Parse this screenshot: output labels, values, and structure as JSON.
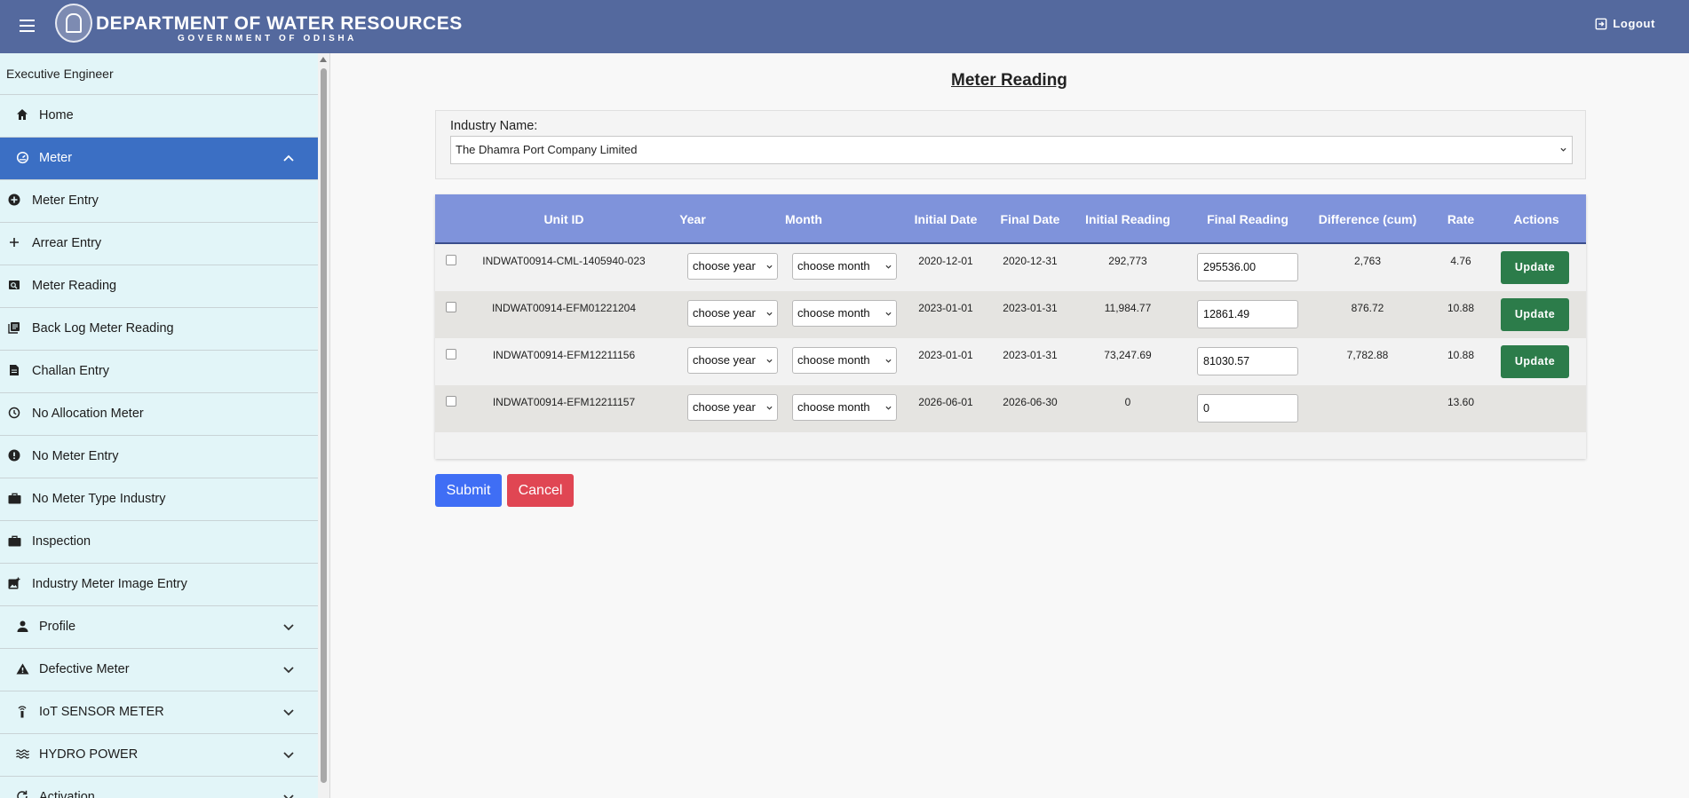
{
  "header": {
    "title": "DEPARTMENT OF WATER RESOURCES",
    "subtitle": "GOVERNMENT OF ODISHA",
    "logout_label": "Logout"
  },
  "sidebar": {
    "user_role": "Executive Engineer",
    "items": [
      {
        "label": "Home",
        "icon": "home-icon"
      },
      {
        "label": "Meter",
        "icon": "meter-icon",
        "active": true,
        "expanded": true
      },
      {
        "label": "Meter Entry",
        "icon": "plus-circle-icon"
      },
      {
        "label": "Arrear Entry",
        "icon": "plus-icon"
      },
      {
        "label": "Meter Reading",
        "icon": "reading-icon"
      },
      {
        "label": "Back Log Meter Reading",
        "icon": "library-icon"
      },
      {
        "label": "Challan Entry",
        "icon": "document-icon"
      },
      {
        "label": "No Allocation Meter",
        "icon": "history-icon"
      },
      {
        "label": "No Meter Entry",
        "icon": "error-icon"
      },
      {
        "label": "No Meter Type Industry",
        "icon": "briefcase-icon"
      },
      {
        "label": "Inspection",
        "icon": "briefcase-icon"
      },
      {
        "label": "Industry Meter Image Entry",
        "icon": "image-add-icon"
      },
      {
        "label": "Profile",
        "icon": "person-icon"
      },
      {
        "label": "Defective Meter",
        "icon": "warning-icon"
      },
      {
        "label": "IoT SENSOR METER",
        "icon": "sensor-icon"
      },
      {
        "label": "HYDRO POWER",
        "icon": "waves-icon"
      },
      {
        "label": "Activation",
        "icon": "refresh-icon"
      }
    ]
  },
  "main": {
    "title": "Meter Reading",
    "industry_label": "Industry Name:",
    "industry_value": "The Dhamra Port Company Limited",
    "table": {
      "headers": [
        "Unit ID",
        "Year",
        "Month",
        "Initial Date",
        "Final Date",
        "Initial Reading",
        "Final Reading",
        "Difference (cum)",
        "Rate",
        "Actions"
      ],
      "rows": [
        {
          "unit_id": "INDWAT00914-CML-1405940-023",
          "year": "choose year",
          "month": "choose month",
          "initial_date": "2020-12-01",
          "final_date": "2020-12-31",
          "initial_reading": "292,773",
          "final_reading": "295536.00",
          "difference": "2,763",
          "rate": "4.76",
          "action": "Update"
        },
        {
          "unit_id": "INDWAT00914-EFM01221204",
          "year": "choose year",
          "month": "choose month",
          "initial_date": "2023-01-01",
          "final_date": "2023-01-31",
          "initial_reading": "11,984.77",
          "final_reading": "12861.49",
          "difference": "876.72",
          "rate": "10.88",
          "action": "Update"
        },
        {
          "unit_id": "INDWAT00914-EFM12211156",
          "year": "choose year",
          "month": "choose month",
          "initial_date": "2023-01-01",
          "final_date": "2023-01-31",
          "initial_reading": "73,247.69",
          "final_reading": "81030.57",
          "difference": "7,782.88",
          "rate": "10.88",
          "action": "Update"
        },
        {
          "unit_id": "INDWAT00914-EFM12211157",
          "year": "choose year",
          "month": "choose month",
          "initial_date": "2026-06-01",
          "final_date": "2026-06-30",
          "initial_reading": "0",
          "final_reading": "0",
          "difference": "",
          "rate": "13.60",
          "action": ""
        }
      ]
    },
    "submit_label": "Submit",
    "cancel_label": "Cancel"
  },
  "colors": {
    "header_bg": "#54699e",
    "sidebar_bg": "#e2f5f8",
    "active_item": "#3b6fc4",
    "table_header": "#7f93db",
    "update_button": "#2c7c4a",
    "submit_button": "#3f6ef5",
    "cancel_button": "#e04653"
  }
}
